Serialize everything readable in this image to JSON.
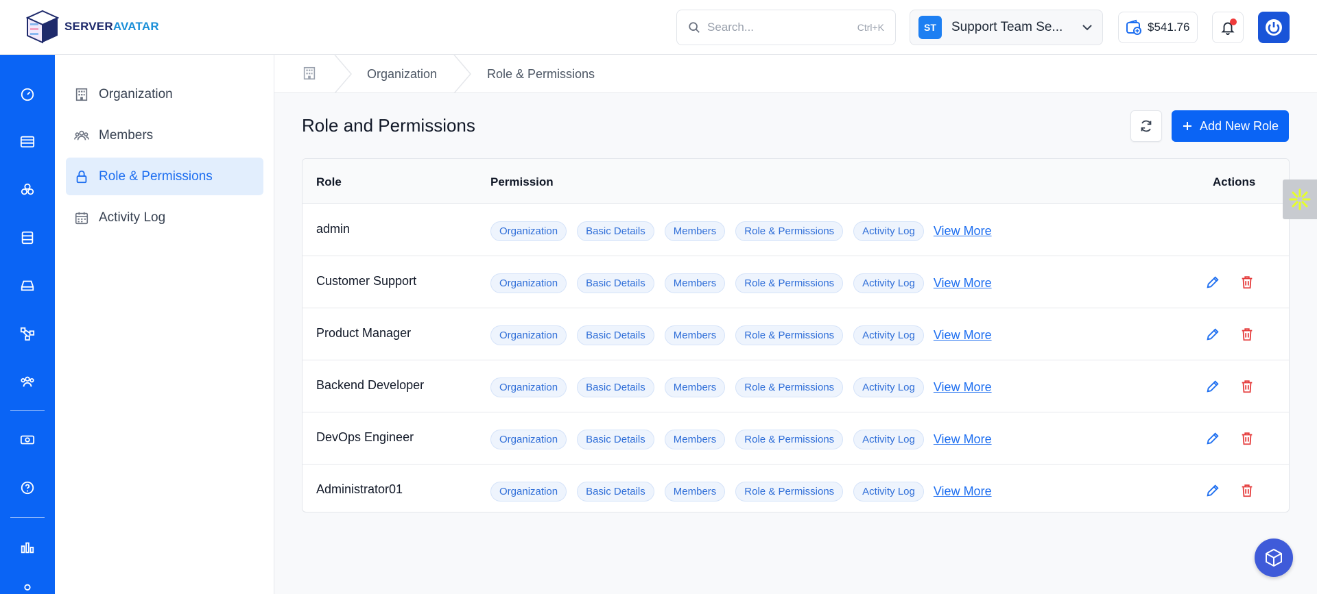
{
  "brand": {
    "name_part1": "SERVER",
    "name_part2": "AVATAR"
  },
  "header": {
    "search_placeholder": "Search...",
    "search_shortcut": "Ctrl+K",
    "org_initials": "ST",
    "org_name": "Support Team Se...",
    "wallet_balance": "$541.76"
  },
  "subnav": {
    "items": [
      {
        "label": "Organization",
        "icon": "building-icon"
      },
      {
        "label": "Members",
        "icon": "users-icon"
      },
      {
        "label": "Role & Permissions",
        "icon": "lock-icon",
        "active": true
      },
      {
        "label": "Activity Log",
        "icon": "calendar-icon"
      }
    ]
  },
  "breadcrumb": {
    "items": [
      "Organization",
      "Role & Permissions"
    ]
  },
  "page": {
    "title": "Role and Permissions",
    "add_button": "Add New Role"
  },
  "table": {
    "headers": {
      "role": "Role",
      "permission": "Permission",
      "actions": "Actions"
    },
    "view_more": "View More",
    "chips": [
      "Organization",
      "Basic Details",
      "Members",
      "Role & Permissions",
      "Activity Log"
    ],
    "rows": [
      {
        "role": "admin",
        "editable": false
      },
      {
        "role": "Customer Support",
        "editable": true
      },
      {
        "role": "Product Manager",
        "editable": true
      },
      {
        "role": "Backend Developer",
        "editable": true
      },
      {
        "role": "DevOps Engineer",
        "editable": true
      },
      {
        "role": "Administrator01",
        "editable": true
      }
    ]
  },
  "colors": {
    "primary": "#0a64f5",
    "danger": "#e53e3e",
    "active_bg": "#e2eefd"
  }
}
